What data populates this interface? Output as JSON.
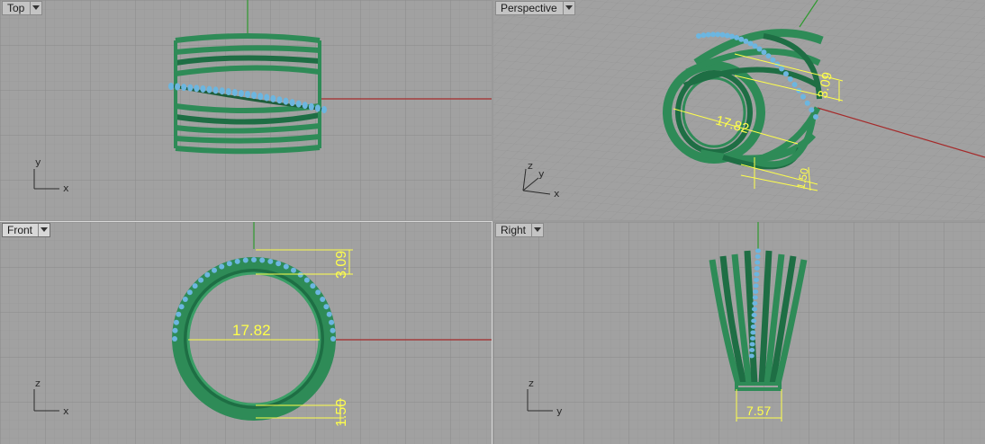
{
  "viewports": {
    "top": {
      "label": "Top",
      "axis_h": "x",
      "axis_v": "y"
    },
    "perspective": {
      "label": "Perspective",
      "axis_x": "x",
      "axis_y": "y",
      "axis_z": "z",
      "dims": {
        "width": "17.82",
        "height": "3.09",
        "thickness": "1.50"
      }
    },
    "front": {
      "label": "Front",
      "axis_h": "x",
      "axis_v": "z",
      "dims": {
        "width": "17.82",
        "height": "3.09",
        "thickness": "1.50"
      }
    },
    "right": {
      "label": "Right",
      "axis_h": "y",
      "axis_v": "z",
      "dims": {
        "width": "7.57"
      }
    }
  },
  "colors": {
    "viewport_bg": "#a1a1a1",
    "grid_minor": "#9a9a9a",
    "grid_major": "#8c8c8c",
    "ring_green": "#2e8b57",
    "ring_dark": "#1e5e3a",
    "gem_blue": "#6cb6e0",
    "dimension_yellow": "#ffff4a",
    "x_axis_red": "#a52a2a",
    "z_axis_green": "#2f9a2f"
  },
  "icons": {
    "viewport_menu": "dropdown-arrow-icon"
  }
}
